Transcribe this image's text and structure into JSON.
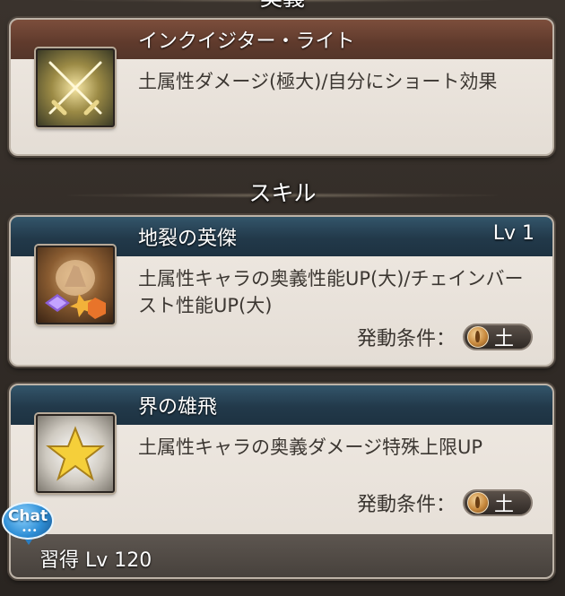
{
  "ougi": {
    "section_title": "奥義",
    "name": "インクイジター・ライト",
    "description": "土属性ダメージ(極大)/自分にショート効果",
    "icon": "crossed-swords-icon"
  },
  "skills": {
    "section_title": "スキル",
    "items": [
      {
        "name": "地裂の英傑",
        "level": "Lv 1",
        "description": "土属性キャラの奥義性能UP(大)/チェインバースト性能UP(大)",
        "condition_label": "発動条件：",
        "condition_element": "土",
        "icon": "earth-hero-icon"
      },
      {
        "name": "界の雄飛",
        "level": "",
        "description": "土属性キャラの奥義ダメージ特殊上限UP",
        "condition_label": "発動条件：",
        "condition_element": "土",
        "acquire_label": "習得 Lv 120",
        "icon": "gold-star-icon"
      }
    ]
  },
  "chat": {
    "label": "Chat"
  },
  "colors": {
    "ougi_bar": "#5f3a2c",
    "skill_bar": "#22394a",
    "card_bg": "#ece6df",
    "earth_orb": "#c8893d"
  }
}
